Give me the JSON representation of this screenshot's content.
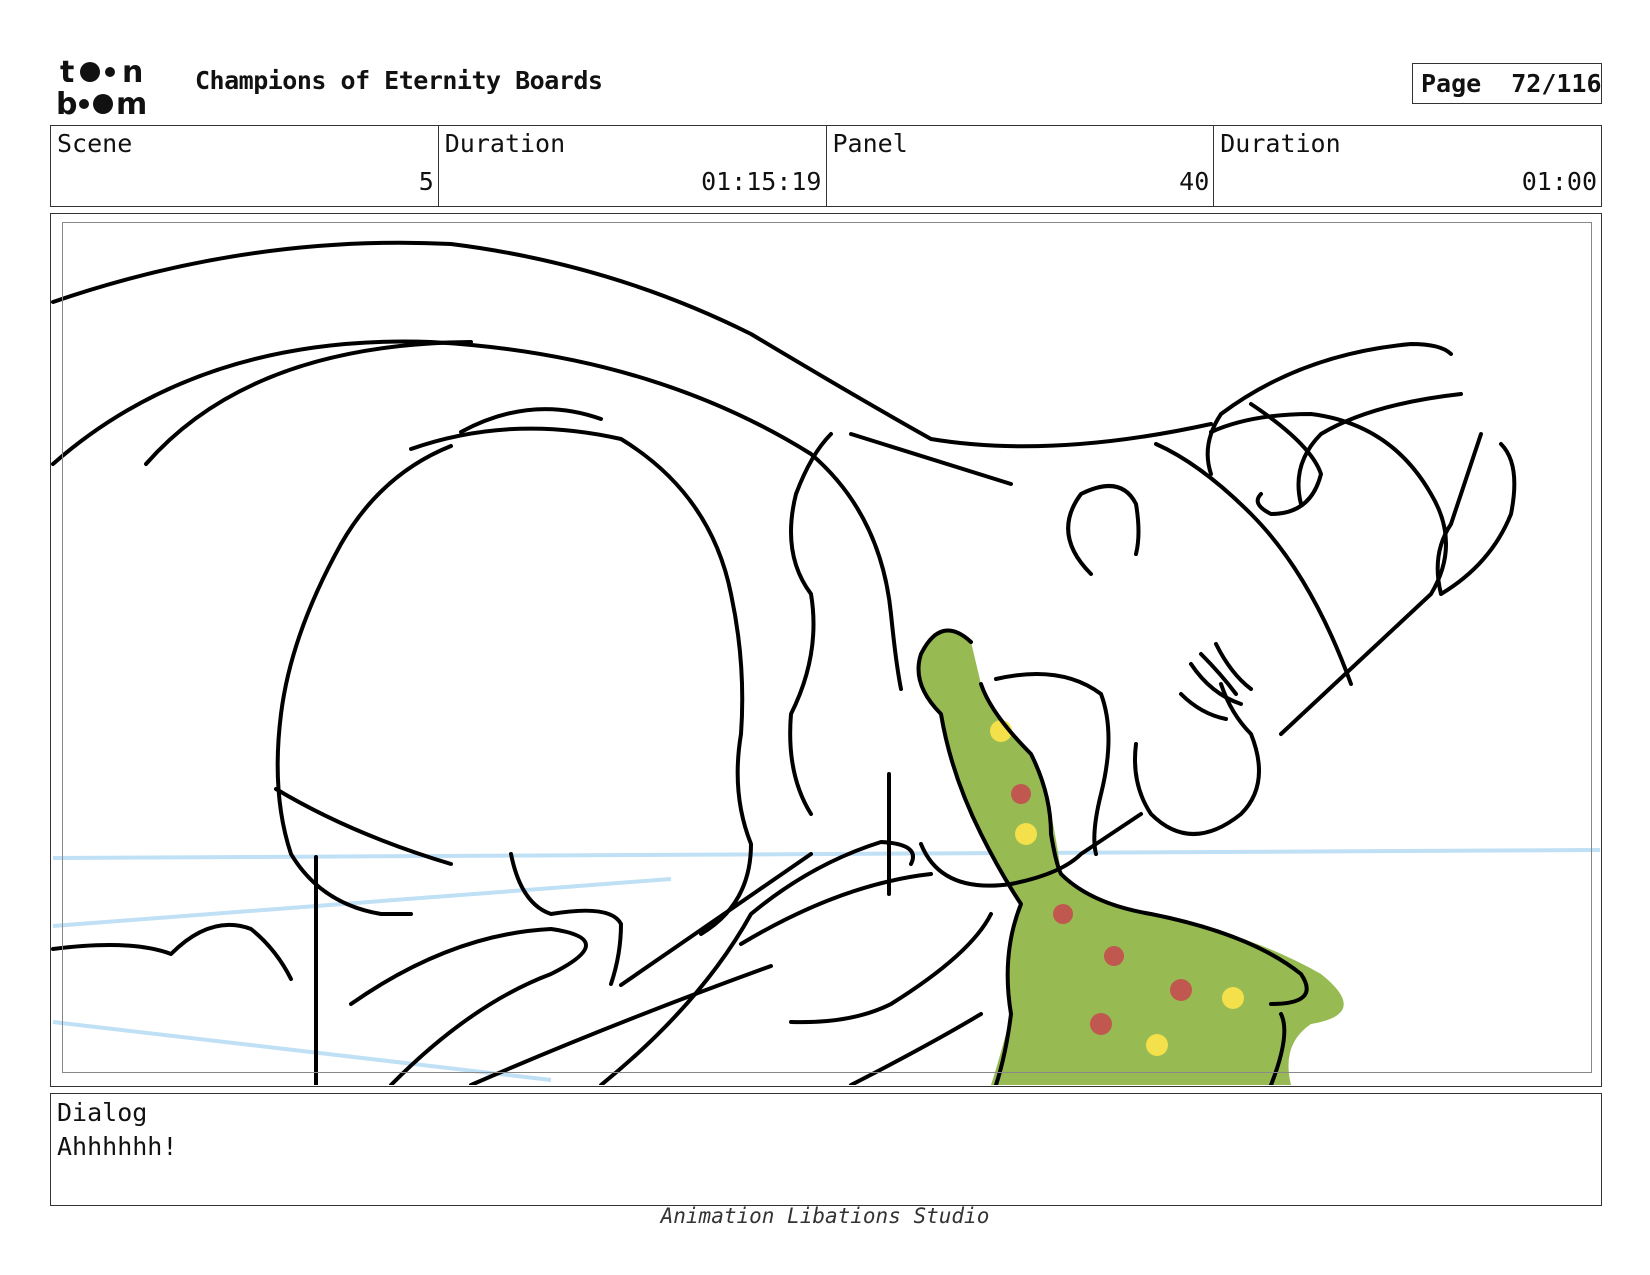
{
  "header": {
    "logo_name": "toon-boom-logo",
    "logo_text_top": "toon",
    "logo_text_bottom": "boom",
    "project_title": "Champions of Eternity Boards",
    "page_label": "Page",
    "page_number": "72/116"
  },
  "info": {
    "scene_label": "Scene",
    "scene_value": "5",
    "scene_duration_label": "Duration",
    "scene_duration_value": "01:15:19",
    "panel_label": "Panel",
    "panel_value": "40",
    "panel_duration_label": "Duration",
    "panel_duration_value": "01:00"
  },
  "panel": {
    "line_color": "#000000",
    "guide_color": "#bfe0f5",
    "fill_color": "#97bb52",
    "dot_red": "#c0584f",
    "dot_yellow": "#f3e04a"
  },
  "dialog": {
    "label": "Dialog",
    "text": "Ahhhhhh!"
  },
  "footer": {
    "studio": "Animation Libations Studio"
  }
}
